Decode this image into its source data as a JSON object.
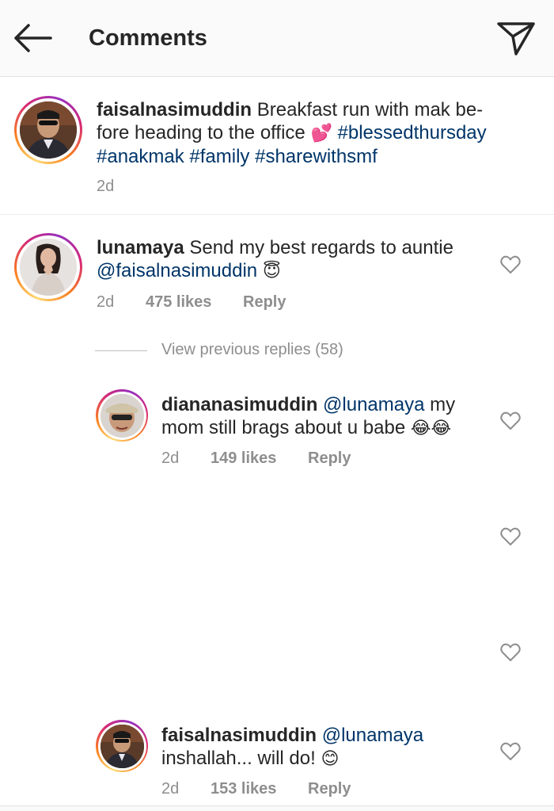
{
  "header": {
    "title": "Comments",
    "back_icon": "arrow-left-icon",
    "share_icon": "paper-plane-icon"
  },
  "caption": {
    "username": "faisalnasimuddin",
    "text_line1": "Breakfast run with mak be-",
    "text_line2": "fore heading to the office",
    "emoji": "💕",
    "hashtag1": "#blessedthursday",
    "hashtag2": "#anakmak",
    "hashtag3": "#family",
    "hashtag4": "#sharewithsmf",
    "time": "2d"
  },
  "comment": {
    "username": "lunamaya",
    "text": "Send my best regards to auntie",
    "mention": "@faisalnasimuddin",
    "emoji": "😇",
    "time": "2d",
    "likes": "475 likes",
    "reply": "Reply"
  },
  "view_previous": "View previous replies (58)",
  "replies": [
    {
      "username": "diananasimuddin",
      "mention": "@lunamaya",
      "text_line1_tail": "my",
      "text_line2": "mom still brags about u babe",
      "emoji": "😂😂",
      "time": "2d",
      "likes": "149 likes",
      "reply": "Reply"
    },
    {
      "username": "faisalnasimuddin",
      "mention": "@lunamaya",
      "text_line2": "inshallah... will do!",
      "emoji": "😊",
      "time": "2d",
      "likes": "153 likes",
      "reply": "Reply"
    }
  ],
  "colors": {
    "link": "#003569",
    "meta": "#8e8e8e",
    "text": "#262626",
    "header_bg": "#fafafa"
  }
}
